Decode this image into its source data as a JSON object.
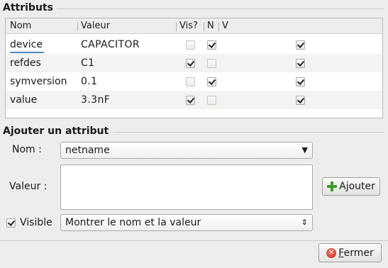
{
  "attributes_section": {
    "title": "Attributs"
  },
  "table": {
    "columns": [
      "Nom",
      "Valeur",
      "Vis?",
      "N",
      "V"
    ],
    "rows": [
      {
        "name": "device",
        "value": "CAPACITOR",
        "vis": false,
        "n": true,
        "v": true
      },
      {
        "name": "refdes",
        "value": "C1",
        "vis": true,
        "n": false,
        "v": true
      },
      {
        "name": "symversion",
        "value": "0.1",
        "vis": false,
        "n": true,
        "v": true
      },
      {
        "name": "value",
        "value": "3.3nF",
        "vis": true,
        "n": false,
        "v": true
      }
    ]
  },
  "add_section": {
    "title": "Ajouter un attribut",
    "name_label": "Nom :",
    "name_value": "netname",
    "value_label": "Valeur :",
    "value_text": "",
    "add_button": {
      "label_before": "A",
      "label_mnemonic": "j",
      "label_after": "outer",
      "icon": "plus-icon"
    },
    "visible_label": "Visible",
    "visible_checked": true,
    "visibility_option": "Montrer le nom et la valeur"
  },
  "close_button": {
    "label_mnemonic": "F",
    "label_after": "ermer",
    "icon": "close-icon"
  },
  "colors": {
    "background": "#ededeb",
    "selection_underline": "#4c87c6",
    "add_icon": "#3c9a2c",
    "close_icon": "#c8281a"
  }
}
